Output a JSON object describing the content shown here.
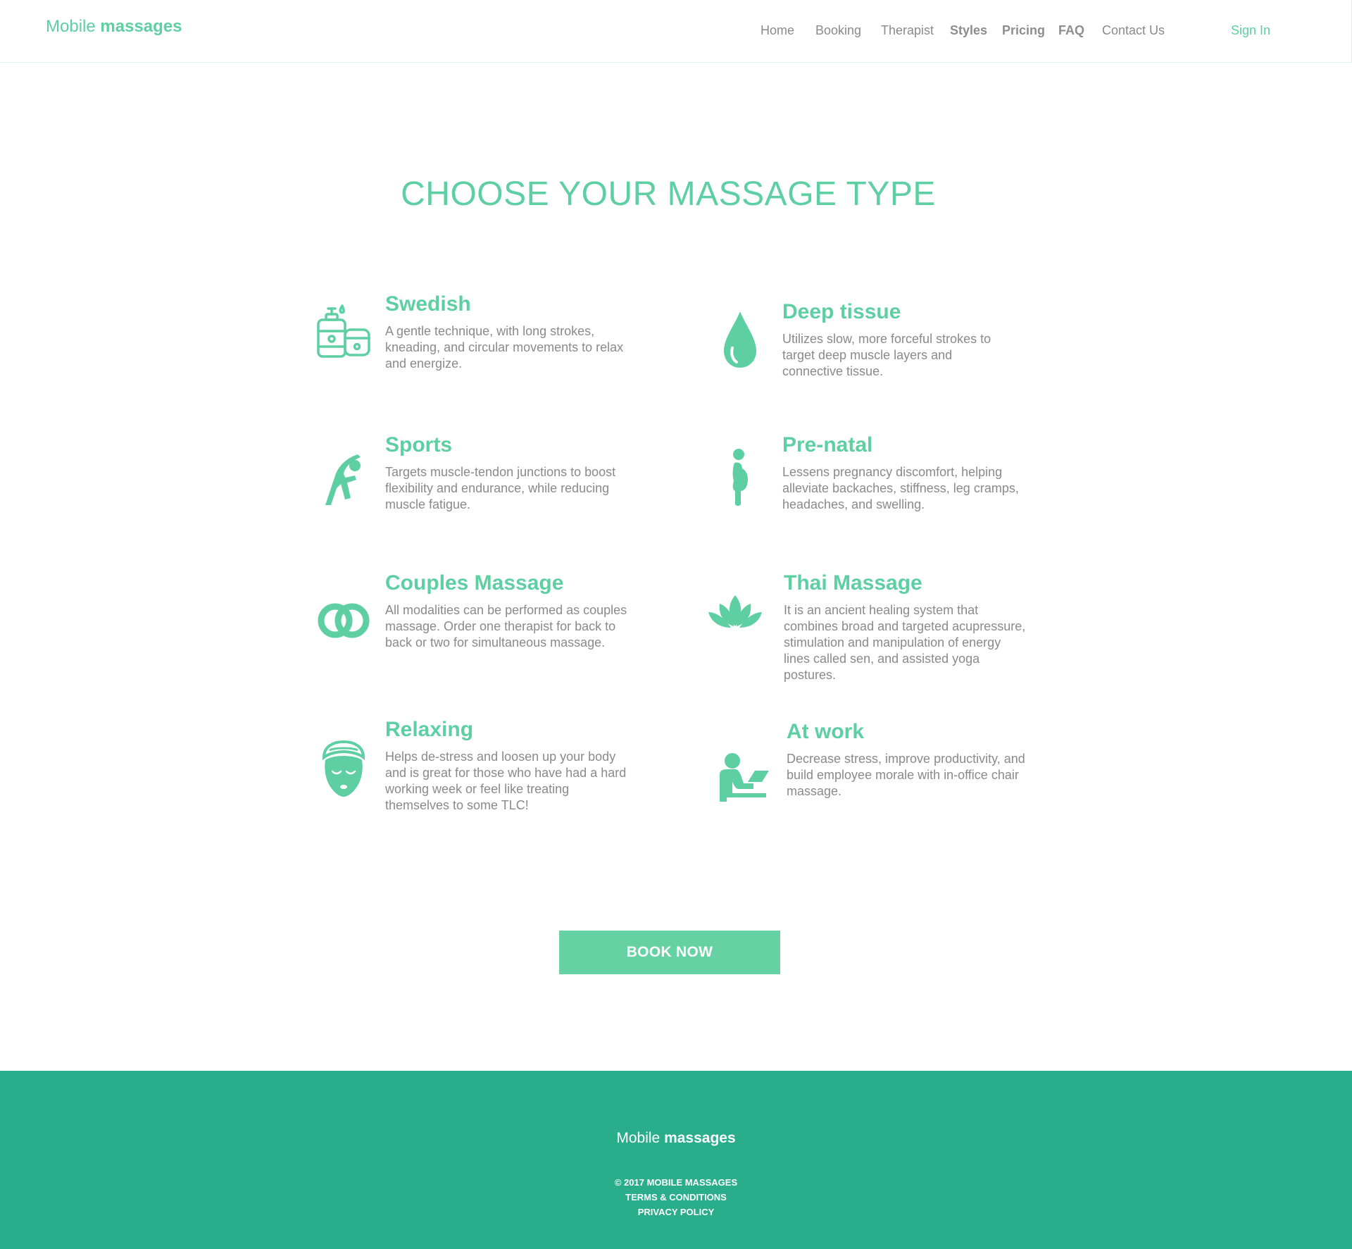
{
  "brand": {
    "name_light": "Mobile",
    "name_bold": "massages",
    "accent_color": "#5ecfa3",
    "footer_color": "#29ad8a",
    "button_color": "#66d2a4"
  },
  "nav": {
    "items": [
      {
        "label": "Home"
      },
      {
        "label": "Booking"
      },
      {
        "label": "Therapist"
      },
      {
        "label": "Styles"
      },
      {
        "label": "Pricing"
      },
      {
        "label": "FAQ"
      },
      {
        "label": "Contact Us"
      }
    ],
    "signin_label": "Sign In"
  },
  "main": {
    "title": "CHOOSE YOUR MASSAGE TYPE",
    "styles": [
      {
        "name": "Swedish",
        "icon": "lotion-bottle-icon",
        "description": "A gentle technique, with long strokes, kneading, and circular movements to relax and energize."
      },
      {
        "name": "Deep tissue",
        "icon": "water-drop-icon",
        "description": "Utilizes slow, more forceful strokes to target deep muscle layers and connective tissue."
      },
      {
        "name": "Sports",
        "icon": "stretching-person-icon",
        "description": "Targets muscle-tendon junctions to boost flexibility and endurance, while reducing muscle fatigue."
      },
      {
        "name": "Pre-natal",
        "icon": "pregnant-woman-icon",
        "description": "Lessens pregnancy discomfort, helping alleviate backaches, stiffness, leg cramps, headaches, and swelling."
      },
      {
        "name": "Couples Massage",
        "icon": "linked-rings-icon",
        "description": "All modalities can be performed as couples massage. Order one therapist for back to back or two for simultaneous massage."
      },
      {
        "name": "Thai Massage",
        "icon": "lotus-flower-icon",
        "description": "It is an ancient healing system that combines broad and targeted acupressure, stimulation and manipulation of energy lines called sen, and assisted yoga postures."
      },
      {
        "name": "Relaxing",
        "icon": "face-mask-towel-icon",
        "description": "Helps de-stress and loosen up your body and is great for those who have had a hard working week or feel like treating themselves to some TLC!"
      },
      {
        "name": "At work",
        "icon": "person-at-laptop-icon",
        "description": "Decrease stress, improve productivity, and build employee morale with in-office chair massage."
      }
    ],
    "book_label": "BOOK NOW"
  },
  "footer": {
    "copyright": "© 2017 MOBILE MASSAGES",
    "terms": "TERMS & CONDITIONS",
    "privacy": "PRIVACY POLICY"
  }
}
